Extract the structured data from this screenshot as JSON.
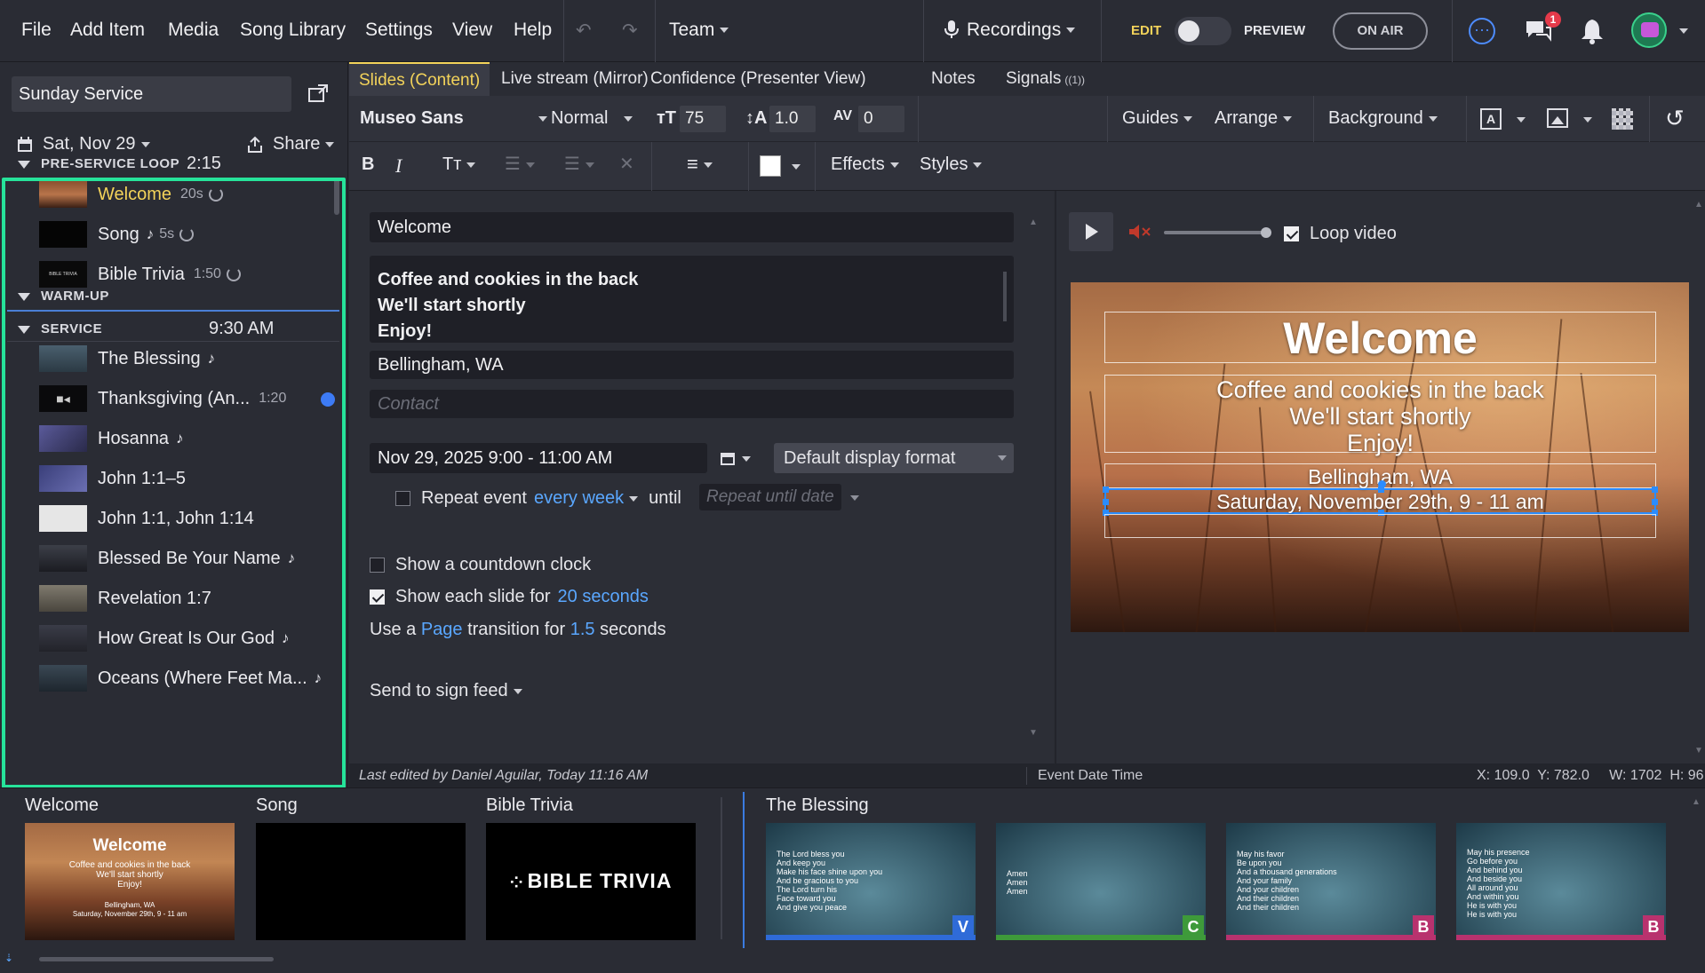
{
  "menubar": {
    "items": [
      "File",
      "Add Item",
      "Media",
      "Song Library",
      "Settings",
      "View",
      "Help"
    ],
    "team": "Team",
    "recordings": "Recordings",
    "edit_label": "EDIT",
    "preview_label": "PREVIEW",
    "on_air": "ON AIR",
    "notif_count": "1"
  },
  "sidebar": {
    "plan_name": "Sunday Service",
    "date": "Sat, Nov 29",
    "share": "Share",
    "sections": [
      {
        "title": "PRE-SERVICE LOOP",
        "meta": "2:15",
        "items": [
          {
            "label": "Welcome",
            "meta": "20s",
            "loop": true,
            "active": true
          },
          {
            "label": "Song",
            "meta": "5s",
            "loop": true,
            "note": true
          },
          {
            "label": "Bible Trivia",
            "meta": "1:50",
            "loop": true
          }
        ]
      },
      {
        "title": "WARM-UP",
        "meta": "",
        "items": []
      },
      {
        "title": "SERVICE",
        "meta": "9:30 AM",
        "items": [
          {
            "label": "The Blessing",
            "note": true
          },
          {
            "label": "Thanksgiving (An...",
            "meta": "1:20"
          },
          {
            "label": "Hosanna",
            "note": true
          },
          {
            "label": "John 1:1–5"
          },
          {
            "label": "John 1:1, John 1:14"
          },
          {
            "label": "Blessed Be Your Name",
            "note": true
          },
          {
            "label": "Revelation 1:7"
          },
          {
            "label": "How Great Is Our God",
            "note": true
          },
          {
            "label": "Oceans (Where Feet Ma...",
            "note": true
          }
        ]
      }
    ]
  },
  "tabs": [
    "Slides (Content)",
    "Live stream (Mirror)",
    "Confidence (Presenter View)",
    "Notes",
    "Signals"
  ],
  "signals_badge": "1",
  "toolbar": {
    "font": "Museo Sans",
    "weight": "Normal",
    "size": "75",
    "line_height": "1.0",
    "spacing": "0",
    "guides": "Guides",
    "arrange": "Arrange",
    "background": "Background",
    "effects": "Effects",
    "styles": "Styles",
    "text_color": "#ffffff"
  },
  "editor": {
    "title": "Welcome",
    "body_lines": [
      "Coffee and cookies in the back",
      "We'll start shortly",
      "Enjoy!"
    ],
    "location": "Bellingham, WA",
    "contact_placeholder": "Contact",
    "datetime": "Nov 29, 2025 9:00 - 11:00 AM",
    "display_format": "Default display format",
    "repeat_label": "Repeat event",
    "repeat_freq": "every week",
    "until": "until",
    "until_placeholder": "Repeat until date",
    "countdown_label": "Show a countdown clock",
    "countdown_checked": false,
    "show_slide_label": "Show each slide for",
    "show_slide_value": "20 seconds",
    "show_slide_checked": true,
    "transition_pre": "Use a",
    "transition_type": "Page",
    "transition_mid": "transition for",
    "transition_value": "1.5",
    "transition_post": "seconds",
    "sign_feed": "Send to sign feed"
  },
  "preview": {
    "loop_label": "Loop video",
    "loop_checked": true,
    "slide_title": "Welcome",
    "slide_lines": [
      "Coffee and cookies in the back",
      "We'll start shortly",
      "Enjoy!"
    ],
    "slide_location": "Bellingham, WA",
    "slide_date": "Saturday, November 29th, 9 - 11 am"
  },
  "status": {
    "edited": "Last edited by Daniel Aguilar, Today 11:16 AM",
    "field": "Event Date Time",
    "coords": "X: 109.0  Y: 782.0     W: 1702  H: 96"
  },
  "strip": {
    "groups": [
      {
        "title": "Welcome"
      },
      {
        "title": "Song"
      },
      {
        "title": "Bible Trivia",
        "thumb_text": "BIBLE TRIVIA"
      },
      {
        "title": "The Blessing"
      }
    ],
    "blessing_slides": [
      {
        "lyrics": [
          "The Lord bless you",
          "And keep you",
          "Make his face shine upon you",
          "And be gracious to you",
          "The Lord turn his",
          "Face toward you",
          "And give you peace"
        ],
        "badge": "V",
        "color": "#2f6bd8"
      },
      {
        "lyrics": [
          "Amen",
          "Amen",
          "Amen"
        ],
        "badge": "C",
        "color": "#3e9a3a"
      },
      {
        "lyrics": [
          "May his favor",
          "Be upon you",
          "And a thousand generations",
          "And your family",
          "And your children",
          "And their children",
          "And their children"
        ],
        "badge": "B",
        "color": "#b8326e"
      },
      {
        "lyrics": [
          "May his presence",
          "Go before you",
          "And behind you",
          "And beside you",
          "All around you",
          "And within you",
          "He is with you",
          "He is with you"
        ],
        "badge": "B",
        "color": "#b8326e"
      }
    ]
  }
}
